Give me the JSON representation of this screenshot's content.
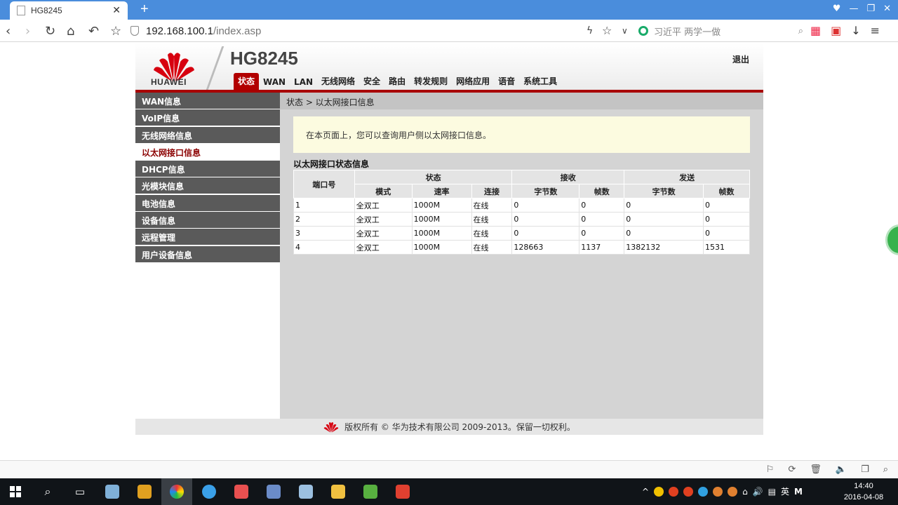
{
  "browser": {
    "tab_title": "HG8245",
    "url_host": "192.168.100.1",
    "url_path": "/index.asp",
    "search_placeholder": "习近平 两学一做"
  },
  "router": {
    "brand": "HUAWEI",
    "model": "HG8245",
    "logout": "退出",
    "menu": [
      "状态",
      "WAN",
      "LAN",
      "无线网络",
      "安全",
      "路由",
      "转发规则",
      "网络应用",
      "语音",
      "系统工具"
    ],
    "sidebar": [
      "WAN信息",
      "VoIP信息",
      "无线网络信息",
      "以太网接口信息",
      "DHCP信息",
      "光模块信息",
      "电池信息",
      "设备信息",
      "远程管理",
      "用户设备信息"
    ],
    "breadcrumb": "状态 > 以太网接口信息",
    "info_text": "在本页面上，您可以查询用户侧以太网接口信息。",
    "section_title": "以太网接口状态信息",
    "table": {
      "h_port": "端口号",
      "h_status": "状态",
      "h_receive": "接收",
      "h_send": "发送",
      "h_mode": "模式",
      "h_speed": "速率",
      "h_link": "连接",
      "h_bytes": "字节数",
      "h_frames": "帧数",
      "rows": [
        [
          "1",
          "全双工",
          "1000M",
          "在线",
          "0",
          "0",
          "0",
          "0"
        ],
        [
          "2",
          "全双工",
          "1000M",
          "在线",
          "0",
          "0",
          "0",
          "0"
        ],
        [
          "3",
          "全双工",
          "1000M",
          "在线",
          "0",
          "0",
          "0",
          "0"
        ],
        [
          "4",
          "全双工",
          "1000M",
          "在线",
          "128663",
          "1137",
          "1382132",
          "1531"
        ]
      ]
    },
    "footer": "版权所有 © 华为技术有限公司 2009-2013。保留一切权利。"
  },
  "taskbar": {
    "tray_lang": "英",
    "time": "14:40",
    "date": "2016-04-08"
  },
  "colors": {
    "huawei_red": "#d7000f",
    "menu_active": "#b20000",
    "sidebar_bg": "#5a5a5a",
    "accent_blue": "#4a8ddc"
  }
}
